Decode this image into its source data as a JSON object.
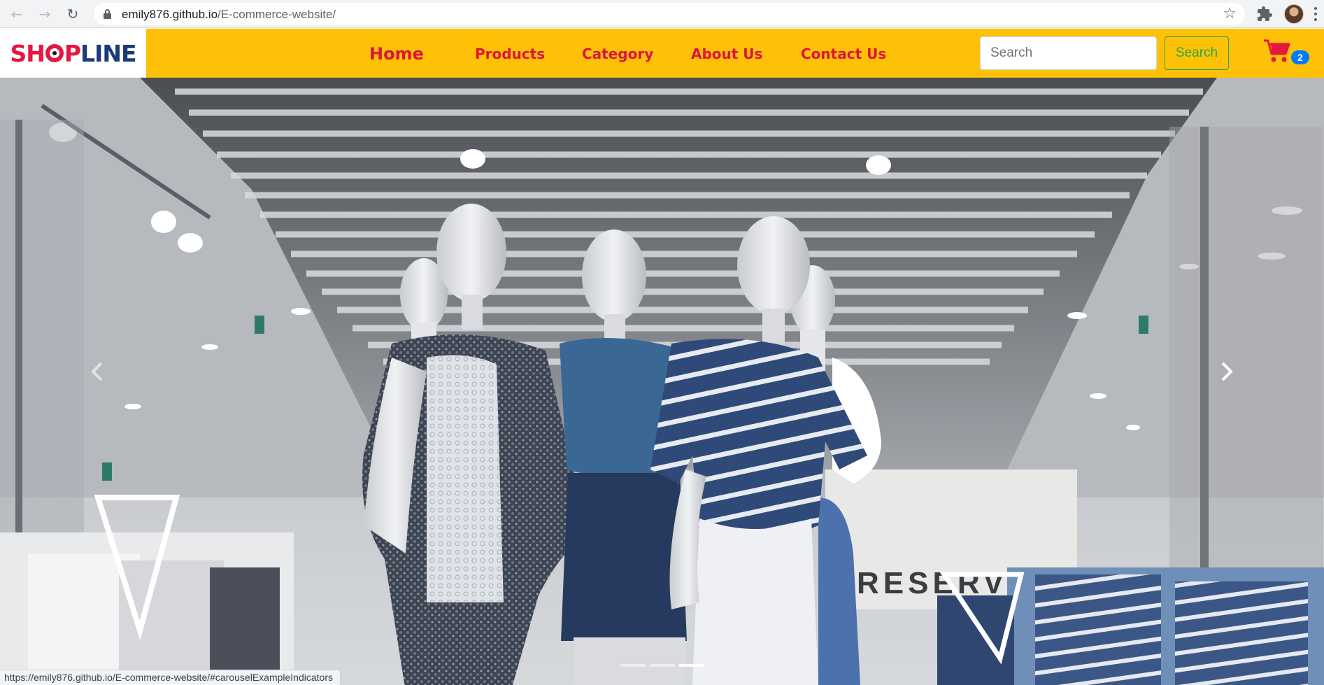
{
  "browser": {
    "url_host": "emily876.github.io",
    "url_path": "/E-commerce-website/",
    "status_url": "https://emily876.github.io/E-commerce-website/#carouselExampleIndicators"
  },
  "navbar": {
    "logo": {
      "part1": "SH",
      "part2": "P",
      "part3": "LINE"
    },
    "links": [
      {
        "label": "Home",
        "active": true
      },
      {
        "label": "Products"
      },
      {
        "label": "Category"
      },
      {
        "label": "About Us"
      },
      {
        "label": "Contact Us"
      }
    ],
    "search_placeholder": "Search",
    "search_button": "Search",
    "cart_count": "2",
    "colors": {
      "bar": "#ffc107",
      "link": "#dc143c",
      "search_button": "#28a745",
      "badge": "#007bff"
    }
  },
  "carousel": {
    "slide_count": 3,
    "active_index": 2,
    "sign_text": "RESERVED"
  }
}
